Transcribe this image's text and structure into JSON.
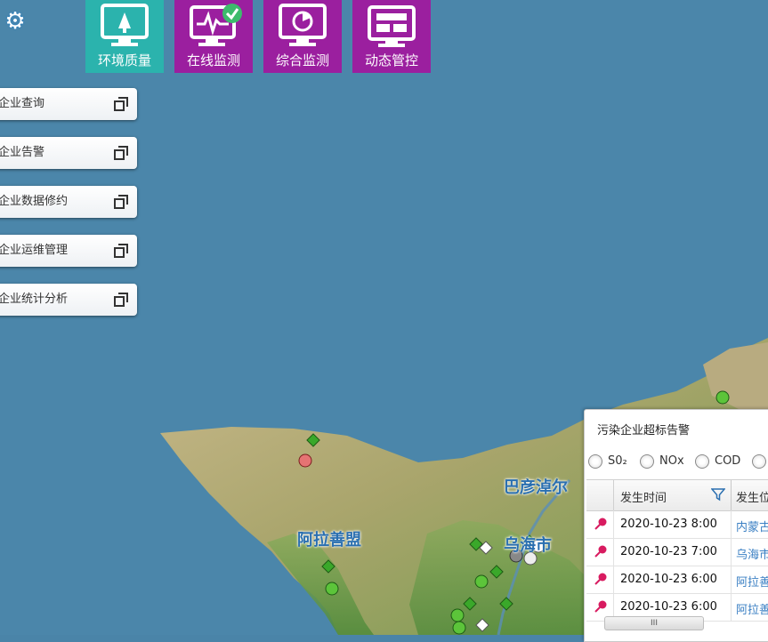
{
  "nav": {
    "items": [
      {
        "label": "环境质量",
        "icon": "monitor-tree-icon"
      },
      {
        "label": "在线监测",
        "icon": "monitor-pulse-check-icon"
      },
      {
        "label": "综合监测",
        "icon": "monitor-pie-icon"
      },
      {
        "label": "动态管控",
        "icon": "monitor-grid-icon"
      }
    ],
    "active_index": 0,
    "colors": {
      "active": "#2bb3ad",
      "inactive": "#9b1f9f"
    }
  },
  "settings_icon": "gear-icon",
  "side_menu": {
    "items": [
      {
        "label": "企业查询"
      },
      {
        "label": "企业告警"
      },
      {
        "label": "企业数据修约"
      },
      {
        "label": "企业运维管理"
      },
      {
        "label": "企业统计分析"
      }
    ],
    "item_icon": "popout-window-icon"
  },
  "map": {
    "labels": [
      {
        "text": "巴彦淖尔"
      },
      {
        "text": "阿拉善盟"
      },
      {
        "text": "乌海市"
      }
    ],
    "colors": {
      "water": "#4a84a8",
      "land_green": "#6e9b48",
      "land_tan": "#cdbb8e",
      "marker_green": "#3aa82a"
    }
  },
  "alarm_panel": {
    "title": "污染企业超标告警",
    "pollutants": [
      "S0₂",
      "NOx",
      "COD"
    ],
    "columns": {
      "time": "发生时间",
      "location": "发生位"
    },
    "rows": [
      {
        "time": "2020-10-23 8:00",
        "location": "内蒙古"
      },
      {
        "time": "2020-10-23 7:00",
        "location": "乌海市"
      },
      {
        "time": "2020-10-23 6:00",
        "location": "阿拉善"
      },
      {
        "time": "2020-10-23 6:00",
        "location": "阿拉善"
      }
    ],
    "scroll_grip": "III",
    "colors": {
      "pin": "#d81b60",
      "link": "#3a7fc3"
    }
  }
}
